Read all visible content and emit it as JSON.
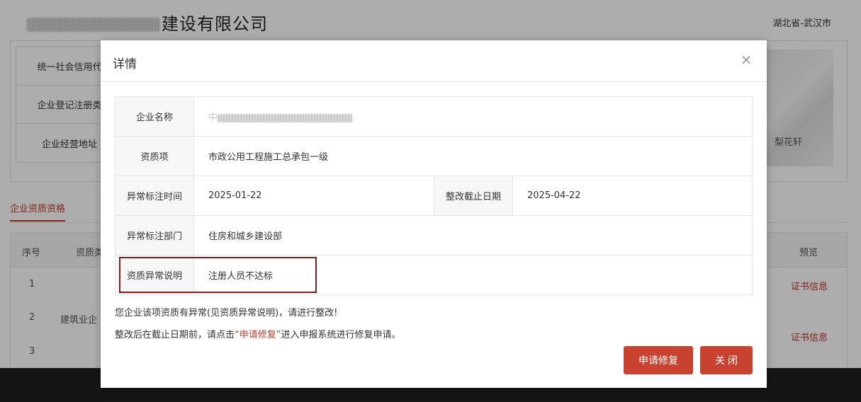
{
  "background": {
    "company_name_visible": "建设有限公司",
    "region": "湖北省-武汉市",
    "info_labels": [
      "统一社会信用代",
      "企业登记注册类",
      "企业经营地址"
    ],
    "map_label": "梨花轩",
    "tab_active": "企业资质资格",
    "table_headers": {
      "index": "序号",
      "type": "资质类",
      "preview": "预览"
    },
    "rows": [
      "1",
      "2",
      "3"
    ],
    "category": "建筑业企",
    "cert_link": "证书信息"
  },
  "modal": {
    "title": "详情",
    "close_glyph": "×",
    "fields": {
      "company_label": "企业名称",
      "company_prefix": "中",
      "qualification_label": "资质项",
      "qualification_value": "市政公用工程施工总承包一级",
      "mark_time_label": "异常标注时间",
      "mark_time_value": "2025-01-22",
      "deadline_label": "整改截止日期",
      "deadline_value": "2025-04-22",
      "department_label": "异常标注部门",
      "department_value": "住房和城乡建设部",
      "reason_label": "资质异常说明",
      "reason_value": "注册人员不达标"
    },
    "notice_line1": "您企业该项资质有异常(见资质异常说明)，请进行整改!",
    "notice_line2_pre": "整改后在截止日期前，请点击",
    "notice_line2_em": "“申请修复”",
    "notice_line2_post": "进入申报系统进行修复申请。",
    "apply_button": "申请修复",
    "close_button": "关 闭"
  },
  "colors": {
    "accent": "#c9412f",
    "highlight_border": "#7a1d1d"
  }
}
